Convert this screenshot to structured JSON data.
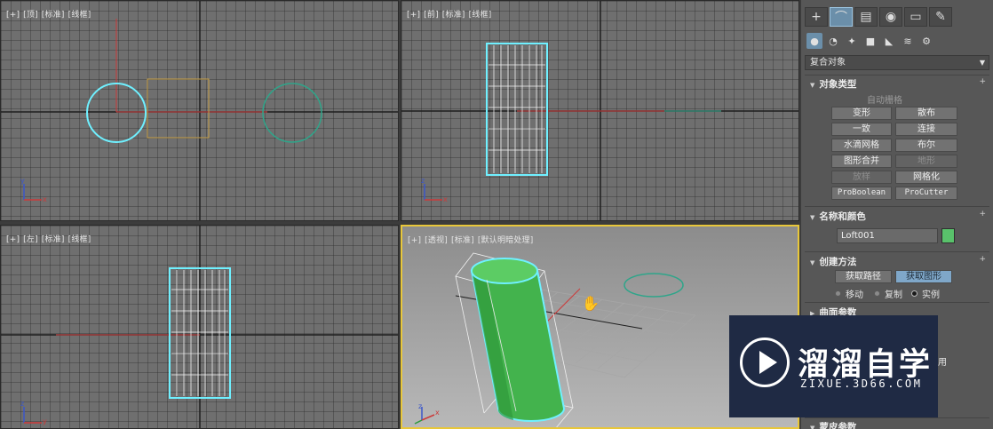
{
  "viewports": {
    "top": {
      "labels": [
        "[+]",
        "[顶]",
        "[标准]",
        "[线框]"
      ],
      "axis_x": "x",
      "axis_y": "y"
    },
    "front": {
      "labels": [
        "[+]",
        "[前]",
        "[标准]",
        "[线框]"
      ],
      "axis_x": "x",
      "axis_y": "z"
    },
    "left": {
      "labels": [
        "[+]",
        "[左]",
        "[标准]",
        "[线框]"
      ],
      "axis_x": "y",
      "axis_y": "z"
    },
    "perspective": {
      "labels": [
        "[+]",
        "[透视]",
        "[标准]",
        "[默认明暗处理]"
      ],
      "axis_x": "x",
      "axis_y": "z"
    },
    "active": "perspective"
  },
  "panel": {
    "tabs": [
      {
        "icon": "create-icon",
        "glyph": "+"
      },
      {
        "icon": "modify-icon",
        "glyph": "⌒"
      },
      {
        "icon": "hierarchy-icon",
        "glyph": "▤"
      },
      {
        "icon": "motion-icon",
        "glyph": "◉"
      },
      {
        "icon": "display-icon",
        "glyph": "▭"
      },
      {
        "icon": "utilities-icon",
        "glyph": "✎"
      }
    ],
    "active_tab": 1,
    "subtabs": [
      {
        "icon": "geometry-icon",
        "glyph": "●"
      },
      {
        "icon": "shapes-icon",
        "glyph": "◔"
      },
      {
        "icon": "lights-icon",
        "glyph": "✦"
      },
      {
        "icon": "cameras-icon",
        "glyph": "■"
      },
      {
        "icon": "helpers-icon",
        "glyph": "◣"
      },
      {
        "icon": "spacewarps-icon",
        "glyph": "≋"
      },
      {
        "icon": "systems-icon",
        "glyph": "⚙"
      }
    ],
    "category": "复合对象",
    "object_type": {
      "title": "对象类型",
      "autogrid": "自动栅格",
      "buttons": [
        {
          "label": "变形",
          "state": "normal"
        },
        {
          "label": "散布",
          "state": "normal"
        },
        {
          "label": "一致",
          "state": "normal"
        },
        {
          "label": "连接",
          "state": "normal"
        },
        {
          "label": "水滴网格",
          "state": "normal"
        },
        {
          "label": "布尔",
          "state": "normal"
        },
        {
          "label": "图形合并",
          "state": "normal"
        },
        {
          "label": "地形",
          "state": "disabled"
        },
        {
          "label": "放样",
          "state": "disabled"
        },
        {
          "label": "网格化",
          "state": "normal"
        },
        {
          "label": "ProBoolean",
          "state": "normal"
        },
        {
          "label": "ProCutter",
          "state": "normal"
        }
      ]
    },
    "name_color": {
      "title": "名称和颜色",
      "name": "Loft001",
      "color": "#59c26b"
    },
    "creation_method": {
      "title": "创建方法",
      "get_path": "获取路径",
      "get_shape": "获取图形",
      "options": [
        "移动",
        "复制",
        "实例"
      ],
      "selected": "实例"
    },
    "surface_params": {
      "title": "曲面参数"
    },
    "skin_params": {
      "title": "蒙皮参数"
    },
    "partial_text": "用"
  },
  "watermark": {
    "title": "溜溜自学",
    "url": "ZIXUE.3D66.COM"
  },
  "colors": {
    "selection_cyan": "#6ff0ff",
    "object_green": "#59c26b",
    "active_border": "#e8c73a",
    "path_red": "#cc3a3a"
  }
}
